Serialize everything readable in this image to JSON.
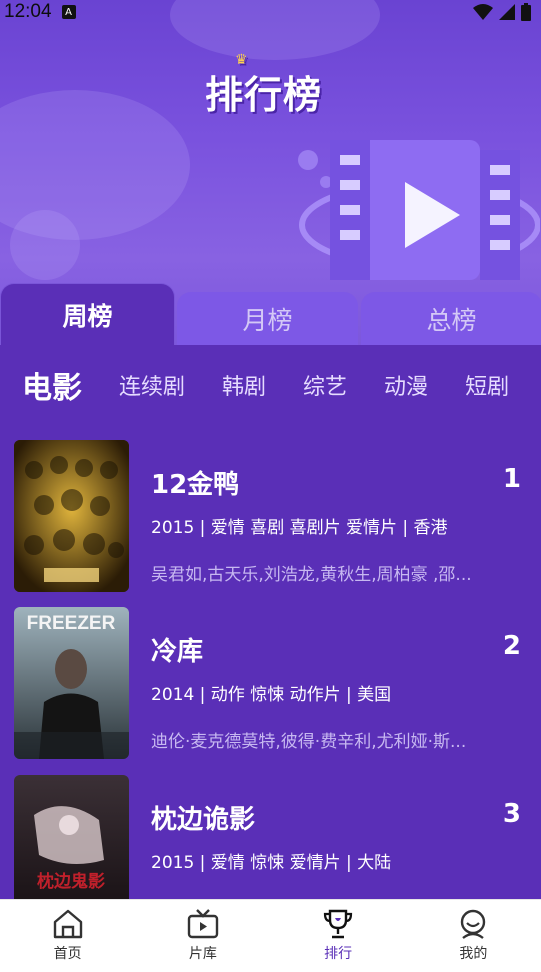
{
  "status_bar": {
    "time": "12:04"
  },
  "header": {
    "title": "排行榜"
  },
  "period_tabs": [
    {
      "label": "周榜",
      "active": true
    },
    {
      "label": "月榜",
      "active": false
    },
    {
      "label": "总榜",
      "active": false
    }
  ],
  "categories": [
    {
      "label": "电影",
      "active": true
    },
    {
      "label": "连续剧"
    },
    {
      "label": "韩剧"
    },
    {
      "label": "综艺"
    },
    {
      "label": "动漫"
    },
    {
      "label": "短剧"
    }
  ],
  "movies": [
    {
      "title": "12金鸭",
      "rank": "1",
      "meta": "2015 | 爱情 喜剧 喜剧片 爱情片 | 香港",
      "cast": "吴君如,古天乐,刘浩龙,黄秋生,周柏豪 ,邵..."
    },
    {
      "title": "冷库",
      "rank": "2",
      "meta": "2014 | 动作 惊悚 动作片 | 美国",
      "cast": "迪伦·麦克德莫特,彼得·费辛利,尤利娅·斯..."
    },
    {
      "title": "枕边诡影",
      "rank": "3",
      "meta": "2015 | 爱情 惊悚 爱情片 | 大陆",
      "cast": ""
    }
  ],
  "poster_text": {
    "freezer": "FREEZER",
    "third": "枕边鬼影"
  },
  "bottom_nav": [
    {
      "label": "首页",
      "icon": "home-icon"
    },
    {
      "label": "片库",
      "icon": "tv-icon"
    },
    {
      "label": "排行",
      "icon": "trophy-icon",
      "active": true
    },
    {
      "label": "我的",
      "icon": "user-icon"
    }
  ],
  "colors": {
    "accent": "#5a2fb7",
    "tab_inactive": "#7d58e6",
    "hero": "#7a52de"
  }
}
